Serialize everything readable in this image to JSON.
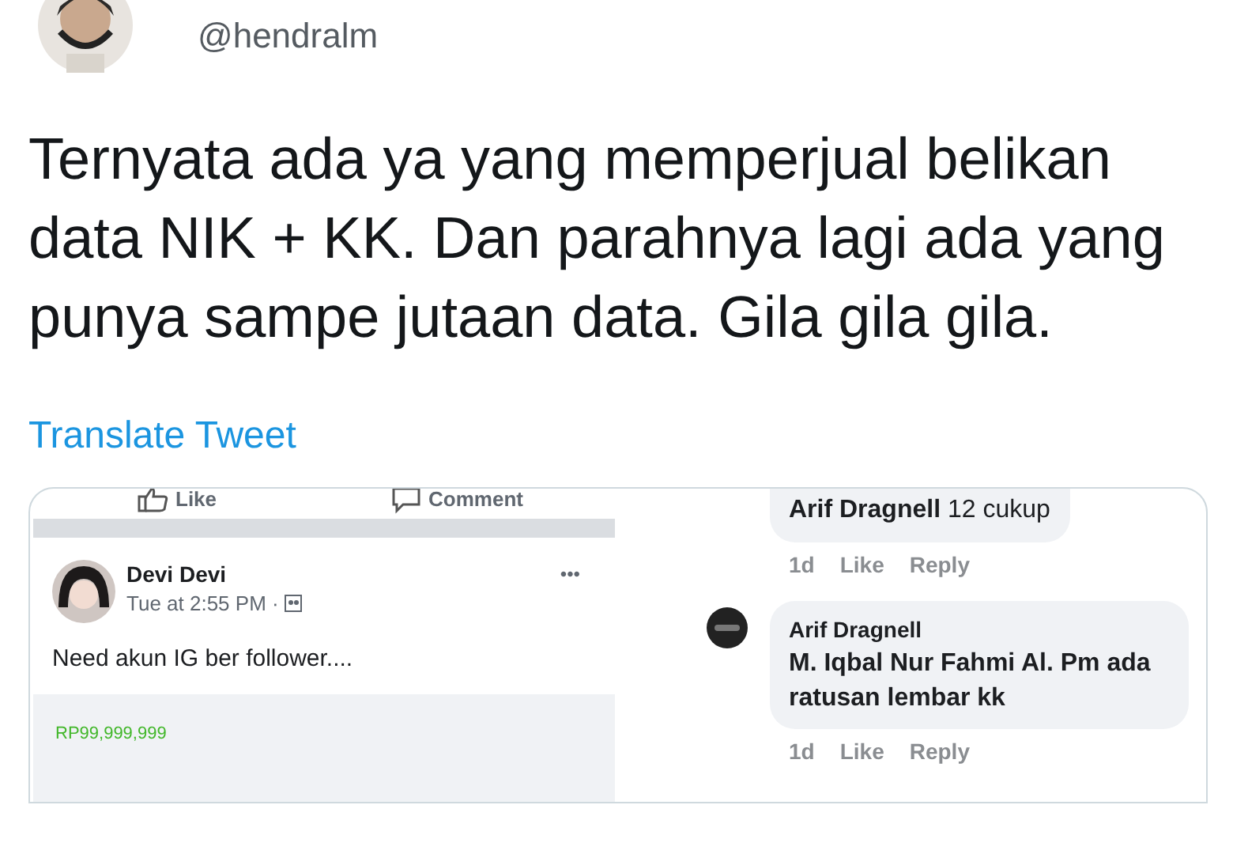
{
  "tweet": {
    "handle": "@hendralm",
    "text": "Ternyata ada ya yang memperjual belikan data NIK + KK. Dan parahnya lagi ada yang punya sampe jutaan data. Gila gila gila.",
    "translate": "Translate Tweet"
  },
  "media": {
    "post": {
      "actions": [
        {
          "kind": "like",
          "label": "Like"
        },
        {
          "kind": "comment",
          "label": "Comment"
        }
      ],
      "author": "Devi Devi",
      "time": "Tue at 2:55 PM ·",
      "more": "•••",
      "text": "Need akun IG ber follower....",
      "price": "RP99,999,999"
    },
    "comments": [
      {
        "kind": "inline",
        "text": "**Arif Dragnell** 12 cukup",
        "age": "1d",
        "like": "Like",
        "reply": "Reply"
      },
      {
        "kind": "full",
        "author": "Arif Dragnell",
        "text": "M. Iqbal Nur Fahmi Al. Pm ada ratusan lembar kk",
        "age": "1d",
        "like": "Like",
        "reply": "Reply"
      }
    ]
  }
}
